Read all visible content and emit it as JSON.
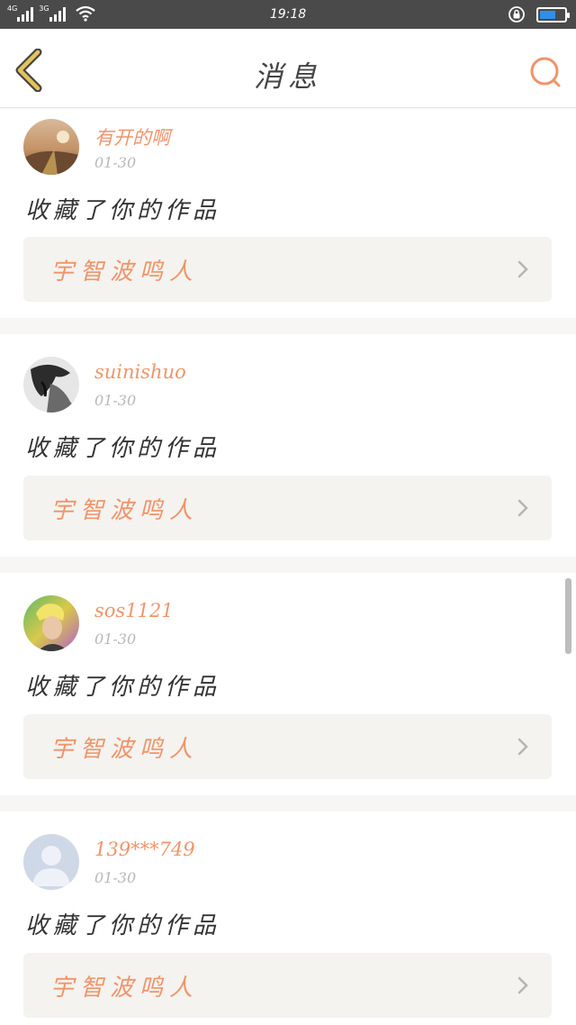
{
  "status_bar": {
    "network_1": "4G",
    "network_2": "3G",
    "time": "19:18",
    "battery_level": 0.65
  },
  "header": {
    "title": "消息",
    "back_icon": "chevron-left-icon",
    "search_icon": "search-icon"
  },
  "colors": {
    "accent": "#f0946a",
    "back_icon": "#e3c45a",
    "card_bg": "#ffffff",
    "separator": "#f7f6f4",
    "work_bg": "#f4f3ef"
  },
  "messages": [
    {
      "username": "有开的啊",
      "date": "01-30",
      "action": "收藏了你的作品",
      "work_title": "宇智波鸣人"
    },
    {
      "username": "suinishuo",
      "date": "01-30",
      "action": "收藏了你的作品",
      "work_title": "宇智波鸣人"
    },
    {
      "username": "sos1121",
      "date": "01-30",
      "action": "收藏了你的作品",
      "work_title": "宇智波鸣人"
    },
    {
      "username": "139***749",
      "date": "01-30",
      "action": "收藏了你的作品",
      "work_title": "宇智波鸣人"
    }
  ]
}
